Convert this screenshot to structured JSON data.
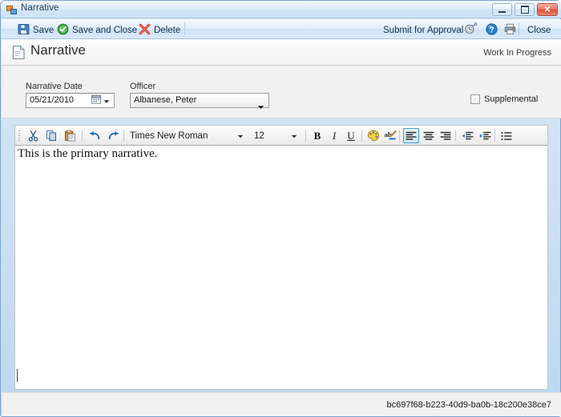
{
  "window": {
    "title": "Narrative",
    "icon": "form-icon",
    "controls": {
      "minimize": "minimize-button",
      "maximize": "maximize-button",
      "close": "close-button",
      "close_glyph": "✕"
    }
  },
  "toolbar": {
    "save_label": "Save",
    "save_and_close_label": "Save and Close",
    "delete_label": "Delete",
    "submit_label": "Submit for Approval",
    "close_label": "Close",
    "icons": {
      "save": "floppy-disk-icon",
      "save_and_close": "green-check-circle-icon",
      "delete": "red-x-icon",
      "history": "history-clock-icon",
      "help": "help-question-icon",
      "print": "printer-icon"
    }
  },
  "header": {
    "title": "Narrative",
    "icon": "document-page-icon",
    "status": "Work In Progress"
  },
  "fields": {
    "date": {
      "label": "Narrative Date",
      "value": "05/21/2010",
      "picker_icon": "calendar-icon",
      "arrow": "▼"
    },
    "officer": {
      "label": "Officer",
      "value": "Albanese, Peter",
      "arrow": "▼",
      "options": [
        "Albanese, Peter"
      ]
    },
    "supplemental": {
      "label": "Supplemental",
      "checked": false
    }
  },
  "editor": {
    "font_name": "Times New Roman",
    "font_size": "12",
    "arrow": "▼",
    "content": "This is the primary narrative.",
    "buttons": [
      {
        "name": "cut-icon",
        "title": "Cut"
      },
      {
        "name": "copy-icon",
        "title": "Copy"
      },
      {
        "name": "paste-icon",
        "title": "Paste"
      },
      {
        "name": "undo-icon",
        "title": "Undo"
      },
      {
        "name": "redo-icon",
        "title": "Redo"
      },
      {
        "name": "bold-icon",
        "title": "Bold",
        "glyph": "B"
      },
      {
        "name": "italic-icon",
        "title": "Italic",
        "glyph": "I"
      },
      {
        "name": "underline-icon",
        "title": "Underline",
        "glyph": "U"
      },
      {
        "name": "font-color-icon",
        "title": "Font Color"
      },
      {
        "name": "highlight-icon",
        "title": "Text Highlight"
      },
      {
        "name": "align-left-icon",
        "title": "Align Left",
        "selected": true
      },
      {
        "name": "align-center-icon",
        "title": "Align Center"
      },
      {
        "name": "align-right-icon",
        "title": "Align Right"
      },
      {
        "name": "decrease-indent-icon",
        "title": "Decrease Indent"
      },
      {
        "name": "increase-indent-icon",
        "title": "Increase Indent"
      },
      {
        "name": "bulleted-list-icon",
        "title": "Bulleted List"
      }
    ]
  },
  "statusbar": {
    "guid": "bc697f68-b223-40d9-ba0b-18c200e38ce7"
  },
  "colors": {
    "window_frame": "#bcd8ef",
    "titlebar": "#e2eefb",
    "accent_blue": "#3c9bd6",
    "close_red": "#d64f33",
    "band_gray": "#f1f1f1"
  }
}
